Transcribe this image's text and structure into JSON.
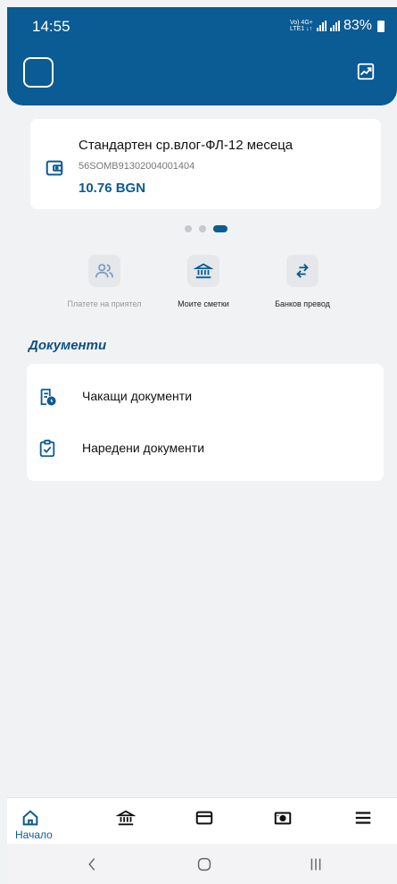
{
  "status_bar": {
    "time": "14:55",
    "network_small": "Vo) 4G+ LTE1 ↓↑",
    "battery": "83%"
  },
  "header": {
    "left_icon": "square-outline-icon",
    "right_icon": "trending-up-icon"
  },
  "account": {
    "name": "Стандартен ср.влог-ФЛ-12 месеца",
    "iban": "56SOMB91302004001404",
    "balance": "10.76 BGN",
    "icon": "wallet-icon"
  },
  "carousel": {
    "count": 3,
    "active": 3
  },
  "quick_actions": [
    {
      "label": "Платете на приятел",
      "icon": "users-icon",
      "enabled": false
    },
    {
      "label": "Моите сметки",
      "icon": "bank-icon",
      "enabled": true
    },
    {
      "label": "Банков превод",
      "icon": "transfer-arrows-icon",
      "enabled": true
    }
  ],
  "documents": {
    "title": "Документи",
    "items": [
      {
        "label": "Чакащи документи",
        "icon": "pending-document-icon"
      },
      {
        "label": "Наредени документи",
        "icon": "clipboard-check-icon"
      }
    ]
  },
  "bottom_nav": {
    "items": [
      {
        "label": "Начало",
        "icon": "home-icon",
        "active": true
      },
      {
        "label": "",
        "icon": "bank-icon",
        "active": false
      },
      {
        "label": "",
        "icon": "card-icon",
        "active": false
      },
      {
        "label": "",
        "icon": "cash-icon",
        "active": false
      },
      {
        "label": "",
        "icon": "menu-icon",
        "active": false
      }
    ]
  },
  "colors": {
    "primary": "#0b5b94",
    "background": "#f1f2f4",
    "card": "#ffffff"
  }
}
